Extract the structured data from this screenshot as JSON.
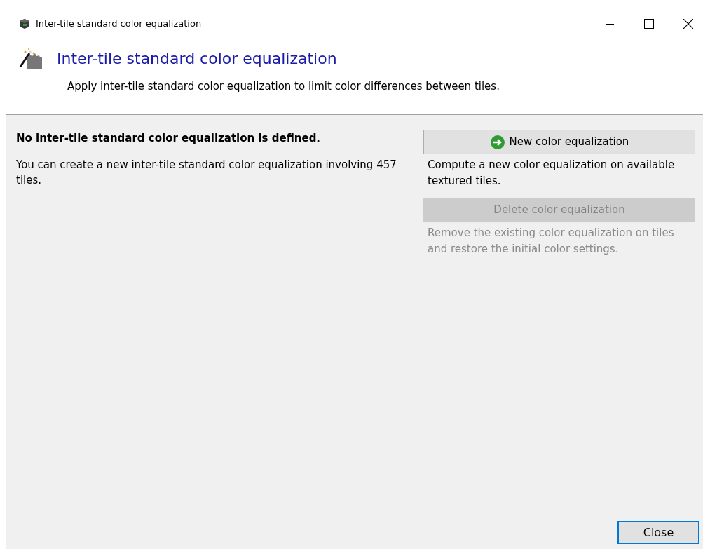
{
  "window": {
    "title": "Inter-tile standard color equalization"
  },
  "header": {
    "title": "Inter-tile standard color equalization",
    "subtitle": "Apply inter-tile standard color equalization to limit color differences between tiles."
  },
  "status": {
    "heading": "No inter-tile standard color equalization is defined.",
    "text": "You can create a new inter-tile standard color equalization involving 457 tiles."
  },
  "actions": [
    {
      "label": "New color equalization",
      "description": "Compute a new color equalization on available textured tiles.",
      "disabled": false,
      "kind": "new"
    },
    {
      "label": "Delete color equalization",
      "description": "Remove the existing color equalization on tiles and restore the initial color settings.",
      "disabled": true,
      "kind": "delete"
    }
  ],
  "close_button": {
    "label": "Close",
    "focused": true
  }
}
